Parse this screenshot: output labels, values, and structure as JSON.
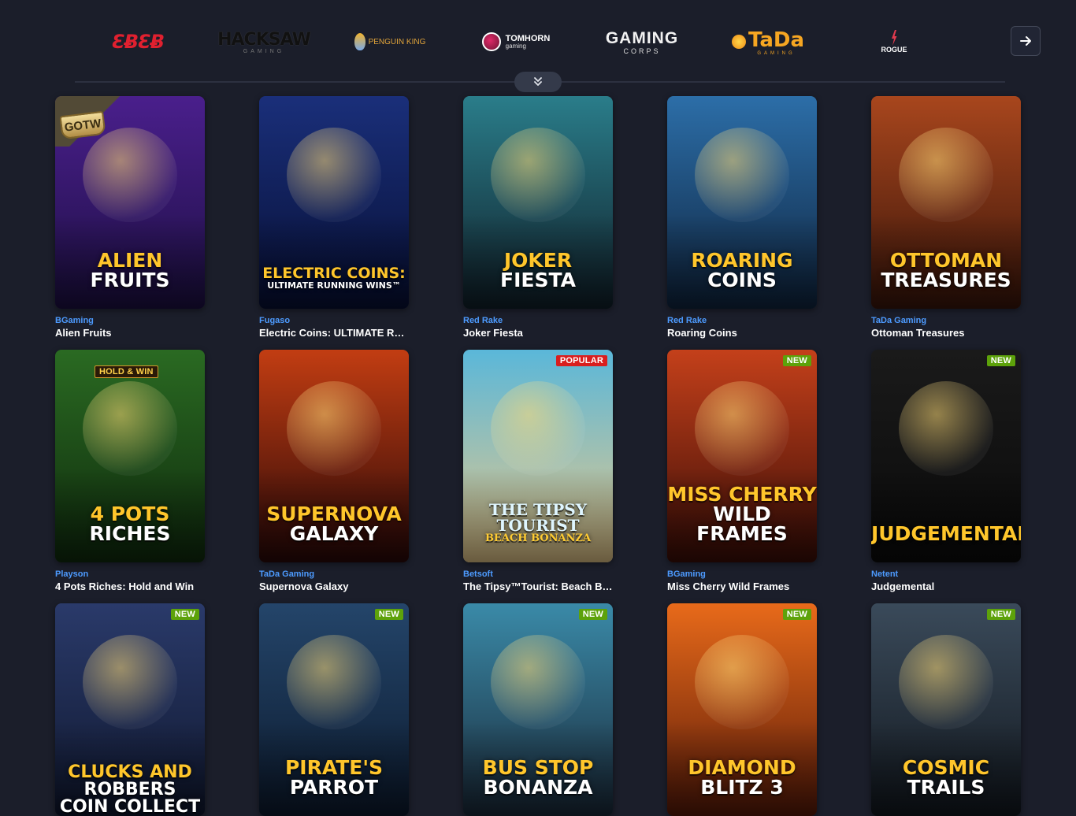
{
  "providers_strip": {
    "logos": [
      {
        "name": "ego",
        "label": "ƐɃƐɃ",
        "sub": ""
      },
      {
        "name": "hacksaw",
        "label": "HACKSAW",
        "sub": "GAMING"
      },
      {
        "name": "penguin",
        "label": "PENGUIN KING",
        "sub": ""
      },
      {
        "name": "tomhorn",
        "label": "TOMHORN",
        "sub": "gaming"
      },
      {
        "name": "gaming",
        "label": "GAMING",
        "sub": "CORPS"
      },
      {
        "name": "tada",
        "label": "TaDa",
        "sub": "GAMING"
      },
      {
        "name": "rogue",
        "label": "ROGUE",
        "sub": ""
      },
      {
        "name": "next",
        "label": "",
        "sub": ""
      }
    ],
    "next_icon": "arrow-right-icon",
    "expand_icon": "chevrons-down-icon"
  },
  "games": [
    {
      "provider": "BGaming",
      "name": "Alien Fruits",
      "title_line1": "ALIEN",
      "title_line2": "FRUITS",
      "badge": "GOTW",
      "colors": [
        "#4a1f8c",
        "#1d0f44"
      ]
    },
    {
      "provider": "Fugaso",
      "name": "Electric Coins: ULTIMATE RUNNING WINS",
      "title_line1": "ELECTRIC COINS:",
      "title_line2": "ULTIMATE RUNNING WINS™",
      "badge": "",
      "colors": [
        "#1a2f7a",
        "#070f35"
      ]
    },
    {
      "provider": "Red Rake",
      "name": "Joker Fiesta",
      "title_line1": "JOKER",
      "title_line2": "FIESTA",
      "badge": "",
      "colors": [
        "#2a7d8a",
        "#10202a"
      ]
    },
    {
      "provider": "Red Rake",
      "name": "Roaring Coins",
      "title_line1": "ROARING",
      "title_line2": "COINS",
      "badge": "",
      "colors": [
        "#2c6ea8",
        "#0f2540"
      ]
    },
    {
      "provider": "TaDa Gaming",
      "name": "Ottoman Treasures",
      "title_line1": "OTTOMAN",
      "title_line2": "TREASURES",
      "badge": "",
      "colors": [
        "#a8461d",
        "#3a150a"
      ]
    },
    {
      "provider": "Playson",
      "name": "4 Pots Riches: Hold and Win",
      "title_line1": "4 POTS",
      "title_line2": "RICHES",
      "badge": "HOLD & WIN",
      "colors": [
        "#2a6a22",
        "#0f2b0d"
      ]
    },
    {
      "provider": "TaDa Gaming",
      "name": "Supernova Galaxy",
      "title_line1": "SUPERNOVA",
      "title_line2": "GALAXY",
      "badge": "",
      "colors": [
        "#c23d12",
        "#2a0808"
      ]
    },
    {
      "provider": "Betsoft",
      "name": "The Tipsy™Tourist: Beach Bonanza",
      "title_line1": "The Tipsy Tourist",
      "title_line2": "Beach Bonanza",
      "badge": "POPULAR",
      "colors": [
        "#5ab7d9",
        "#e8c98a"
      ]
    },
    {
      "provider": "BGaming",
      "name": "Miss Cherry Wild Frames",
      "title_line1": "MISS CHERRY",
      "title_line2": "WILD FRAMES",
      "badge": "NEW",
      "colors": [
        "#c4401a",
        "#3b0d07"
      ]
    },
    {
      "provider": "Netent",
      "name": "Judgemental",
      "title_line1": "JUDGEMENTAL",
      "title_line2": "",
      "badge": "NEW",
      "colors": [
        "#1a1a1a",
        "#0a0a0a"
      ]
    },
    {
      "provider": "",
      "name": "",
      "title_line1": "CLUCKS AND",
      "title_line2": "ROBBERS",
      "title_line3": "COIN COLLECT",
      "badge": "NEW",
      "colors": [
        "#2a3a6a",
        "#101830"
      ]
    },
    {
      "provider": "",
      "name": "",
      "title_line1": "PIRATE'S",
      "title_line2": "PARROT",
      "badge": "NEW",
      "colors": [
        "#24456a",
        "#0c1a2e"
      ]
    },
    {
      "provider": "",
      "name": "",
      "title_line1": "BUS STOP",
      "title_line2": "BONANZA",
      "badge": "NEW",
      "colors": [
        "#3a8aa8",
        "#1a2a3a"
      ]
    },
    {
      "provider": "",
      "name": "",
      "title_line1": "DIAMOND",
      "title_line2": "BLITZ 3",
      "badge": "NEW",
      "colors": [
        "#e86a1a",
        "#5a1a08"
      ]
    },
    {
      "provider": "",
      "name": "",
      "title_line1": "COSMIC",
      "title_line2": "TRAILS",
      "badge": "NEW",
      "colors": [
        "#3a4a5a",
        "#12181f"
      ]
    }
  ]
}
